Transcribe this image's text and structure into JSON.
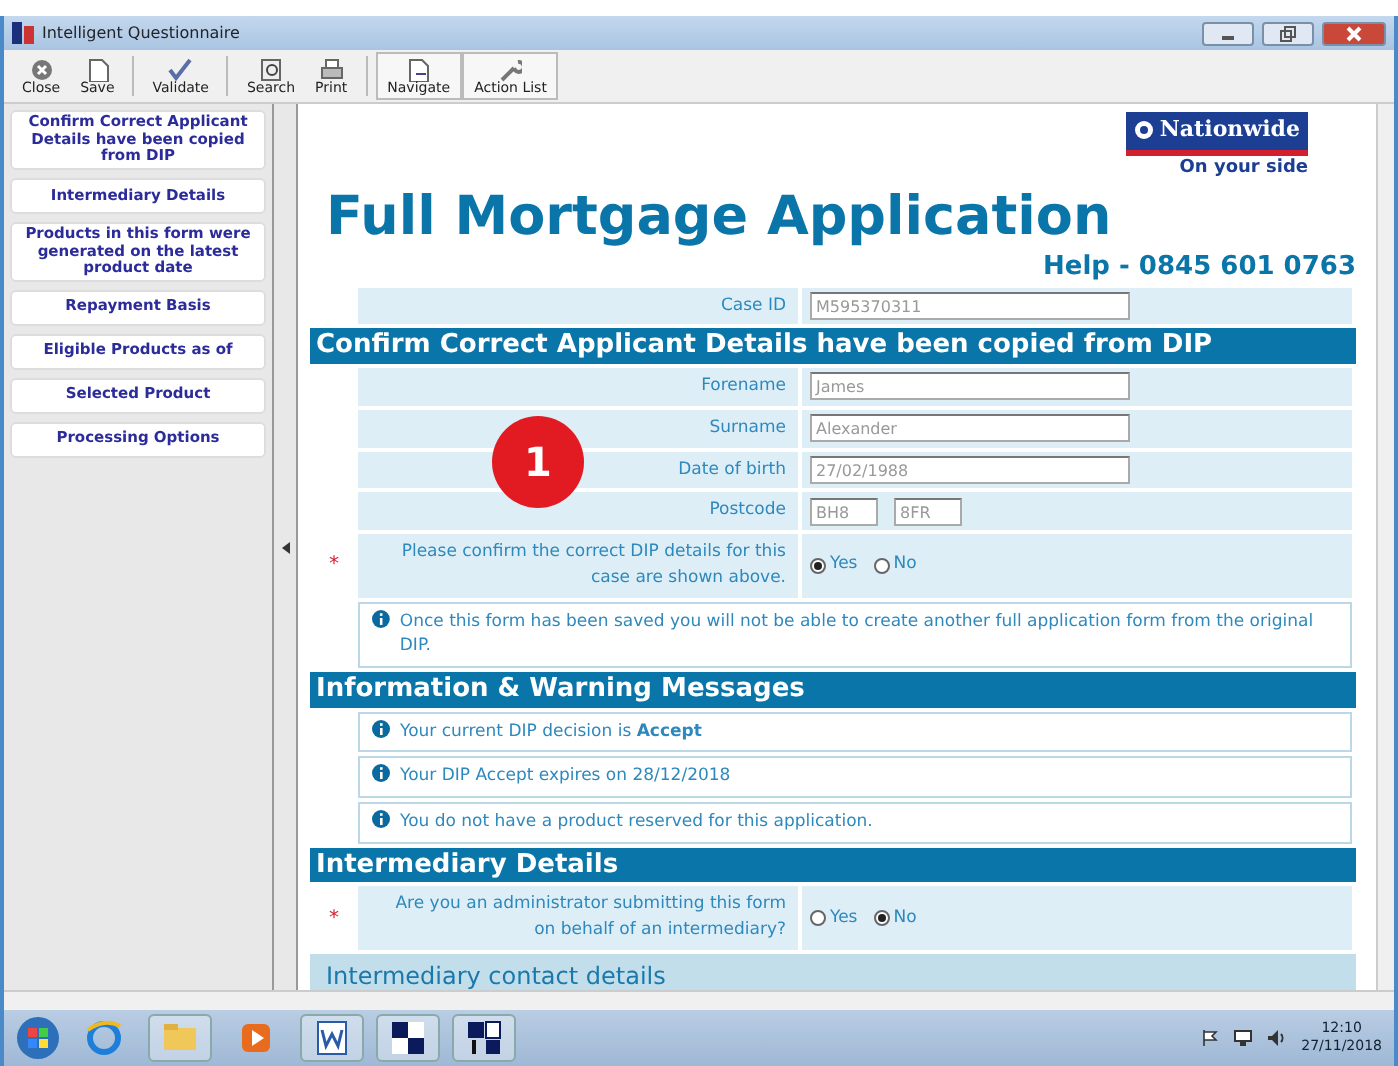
{
  "window": {
    "title": "Intelligent Questionnaire"
  },
  "toolbar": [
    {
      "label": "Close",
      "pressed": false
    },
    {
      "label": "Save",
      "pressed": false
    },
    {
      "label": "Validate",
      "pressed": false
    },
    {
      "label": "Search",
      "pressed": false
    },
    {
      "label": "Print",
      "pressed": false
    },
    {
      "label": "Navigate",
      "pressed": true
    },
    {
      "label": "Action List",
      "pressed": true
    }
  ],
  "sidebar": {
    "items": [
      {
        "label": "Confirm Correct Applicant Details have been copied from DIP"
      },
      {
        "label": "Intermediary Details"
      },
      {
        "label": "Products in this form were generated on the latest product date"
      },
      {
        "label": "Repayment Basis"
      },
      {
        "label": "Eligible Products as of"
      },
      {
        "label": "Selected Product"
      },
      {
        "label": "Processing Options"
      }
    ]
  },
  "form": {
    "logo": {
      "name": "Nationwide",
      "tagline": "On your side"
    },
    "title": "Full Mortgage Application",
    "help": "Help - 0845 601 0763",
    "case_id": {
      "label": "Case ID",
      "value": "M595370311"
    },
    "sections": [
      {
        "heading": "Confirm Correct Applicant Details have been copied from DIP",
        "rows": [
          {
            "kind": "field",
            "label": "Forename",
            "values": [
              "James"
            ]
          },
          {
            "kind": "field",
            "label": "Surname",
            "values": [
              "Alexander"
            ]
          },
          {
            "kind": "field",
            "label": "Date of birth",
            "values": [
              "27/02/1988"
            ]
          },
          {
            "kind": "postcode",
            "label": "Postcode",
            "values": [
              "BH8",
              "8FR"
            ]
          },
          {
            "kind": "radio",
            "marker": "*",
            "label": "Please confirm the correct DIP details for this case are shown above.",
            "options": [
              {
                "label": "Yes",
                "selected": true
              },
              {
                "label": "No",
                "selected": false
              }
            ]
          },
          {
            "kind": "info",
            "text": "Once this form has been saved you will not be able to create another full application form from the original DIP."
          }
        ]
      },
      {
        "heading": "Information & Warning Messages",
        "rows": [
          {
            "kind": "info",
            "text": "Your current DIP decision is **Accept**"
          },
          {
            "kind": "info",
            "text": "Your DIP Accept expires on 28/12/2018"
          },
          {
            "kind": "info",
            "text": "You do not have a product reserved for this application."
          }
        ]
      },
      {
        "heading": "Intermediary Details",
        "rows": [
          {
            "kind": "radio",
            "marker": "*",
            "label": "Are you an administrator submitting this form on behalf of an intermediary?",
            "options": [
              {
                "label": "Yes",
                "selected": false
              },
              {
                "label": "No",
                "selected": true
              }
            ]
          },
          {
            "kind": "subheading",
            "text": "Intermediary contact details"
          }
        ]
      }
    ]
  },
  "annotation": {
    "badge": "1"
  },
  "taskbar": {
    "time": "12:10",
    "date": "27/11/2018"
  }
}
